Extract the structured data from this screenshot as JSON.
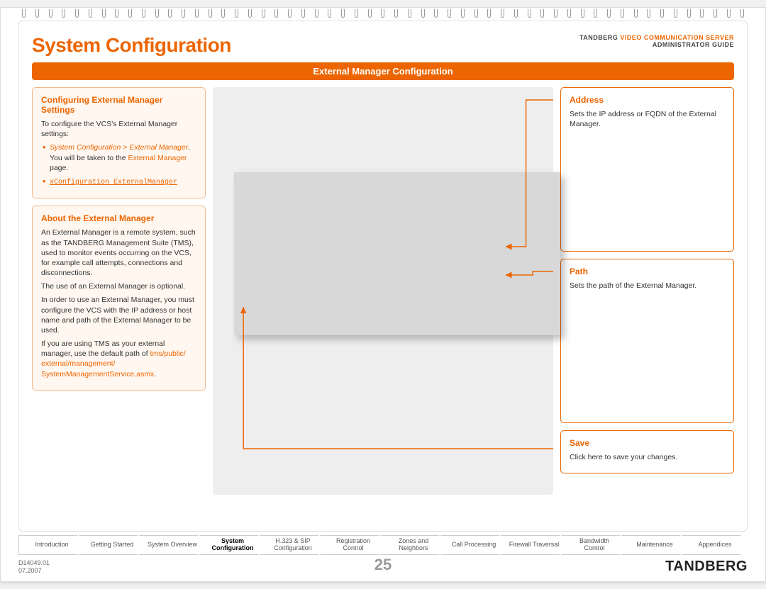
{
  "header": {
    "title": "System Configuration",
    "brand": "TANDBERG",
    "product": "VIDEO COMMUNICATION SERVER",
    "subtitle": "ADMINISTRATOR GUIDE"
  },
  "banner": "External Manager Configuration",
  "left": {
    "box1": {
      "title": "Configuring External Manager Settings",
      "intro": "To configure the VCS's External Manager settings:",
      "nav_path": "System Configuration > External Manager",
      "nav_rest": ". You will be taken to the ",
      "nav_link": "External Manager",
      "nav_tail": " page.",
      "cmd": "xConfiguration ExternalManager"
    },
    "box2": {
      "title": "About the External Manager",
      "p1": "An External Manager is a remote system, such as the TANDBERG Management Suite (TMS), used to monitor events occurring on the VCS, for example call attempts, connections and disconnections.",
      "p2": "The use of an External Manager is optional.",
      "p3": "In order to use an External Manager, you must configure the VCS with the IP address or host name and path of the External Manager to be used.",
      "p4a": "If you are using TMS as your external manager, use the default path of ",
      "p4b": "tms/public/ external/management/ SystemManagementService.asmx",
      "p4c": "."
    }
  },
  "right": {
    "address": {
      "title": "Address",
      "text": "Sets the IP address or FQDN of the External Manager."
    },
    "path": {
      "title": "Path",
      "text": "Sets the path of the External Manager."
    },
    "save": {
      "title": "Save",
      "text": "Click here to save your changes."
    }
  },
  "tabs": [
    "Introduction",
    "Getting Started",
    "System Overview",
    "System Configuration",
    "H.323 & SIP Configuration",
    "Registration Control",
    "Zones and Neighbors",
    "Call Processing",
    "Firewall Traversal",
    "Bandwidth Control",
    "Maintenance",
    "Appendices"
  ],
  "active_tab_index": 3,
  "footer": {
    "doc_id": "D14049.01",
    "date": "07.2007",
    "page": "25",
    "brand": "TANDBERG"
  }
}
